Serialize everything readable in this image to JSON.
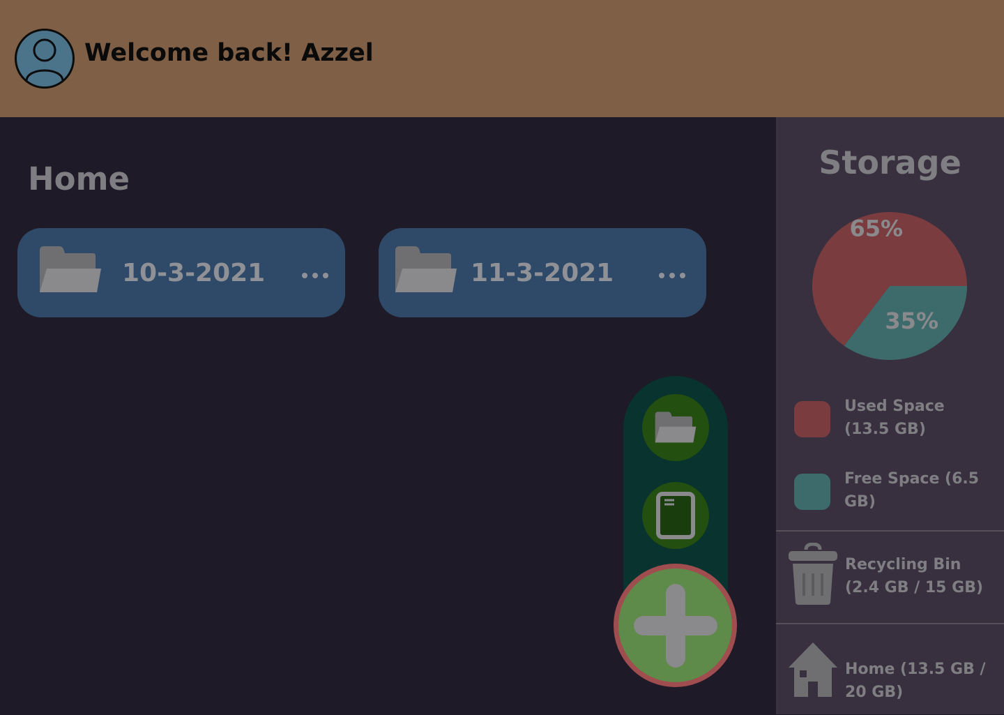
{
  "header": {
    "welcome_text": "Welcome back! Azzel",
    "avatar_icon": "user-avatar-icon",
    "background_color": "#7f5f45"
  },
  "main": {
    "page_title": "Home",
    "folders": [
      {
        "name": "10-3-2021",
        "icon": "folder-icon",
        "menu_icon": "more-horizontal-icon"
      },
      {
        "name": "11-3-2021",
        "icon": "folder-icon",
        "menu_icon": "more-horizontal-icon"
      }
    ],
    "fab": {
      "actions": [
        {
          "icon": "new-folder-icon"
        },
        {
          "icon": "new-file-icon"
        }
      ],
      "main_icon": "plus-icon"
    }
  },
  "sidebar": {
    "title": "Storage",
    "chart_data": {
      "type": "pie",
      "slices": [
        {
          "label": "65%",
          "value": 65,
          "color": "#7a3c3f"
        },
        {
          "label": "35%",
          "value": 35,
          "color": "#3d6b6c"
        }
      ]
    },
    "legend": [
      {
        "text": "Used Space (13.5 GB)",
        "color": "#7a3c3f"
      },
      {
        "text": "Free Space (6.5 GB)",
        "color": "#3d6b6c"
      }
    ],
    "items": [
      {
        "label": "Recycling Bin (2.4 GB / 15 GB)",
        "icon": "trash-icon"
      },
      {
        "label": "Home (13.5 GB / 20 GB)",
        "icon": "home-icon"
      }
    ]
  }
}
